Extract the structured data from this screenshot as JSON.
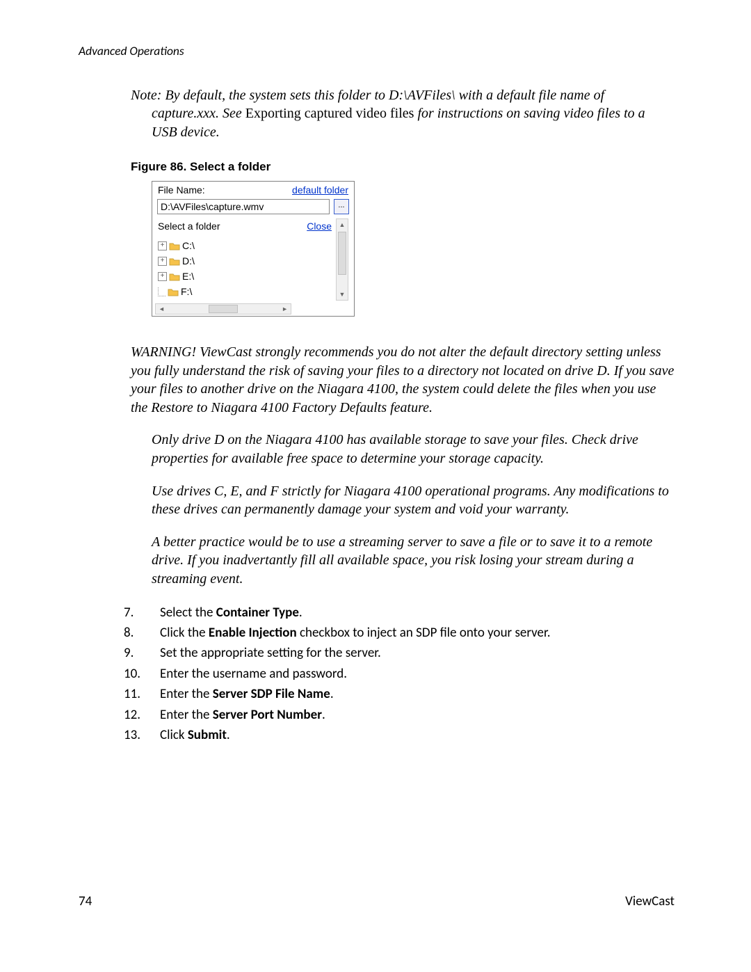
{
  "header": {
    "section_title": "Advanced Operations"
  },
  "note": {
    "prefix": "Note: ",
    "line1_a": "By default, the system sets this folder to D:\\AVFiles\\ with a default file name of ",
    "line2_a": "capture.xxx. See ",
    "line2_plain": "Exporting captured video files",
    "line2_b": " for instructions on saving video files to a ",
    "line3": "USB device."
  },
  "figure": {
    "caption": "Figure 86. Select a folder",
    "file_name_label": "File Name:",
    "default_folder_link": "default folder",
    "path_value": "D:\\AVFiles\\capture.wmv",
    "browse_label": "...",
    "select_folder_label": "Select a folder",
    "close_link": "Close",
    "drives": [
      "C:\\",
      "D:\\",
      "E:\\",
      "F:\\"
    ]
  },
  "warning": {
    "p1": "WARNING!  ViewCast strongly recommends you do not alter the default directory setting unless you fully understand the risk of saving your files to a directory not located on drive D. If you save your files to another drive on the Niagara 4100, the system could delete the files when you use the Restore to Niagara 4100 Factory Defaults feature.",
    "p2": "Only drive D on the Niagara 4100 has available storage to save your files. Check drive properties for available free space to determine your storage capacity.",
    "p3": "Use drives C, E, and F strictly for Niagara 4100 operational programs. Any modifications to these drives can permanently damage your system and void your warranty.",
    "p4": "A better practice would be to use a streaming server to save a file or to save it to a remote drive. If you inadvertantly fill all available space, you risk losing your stream during a streaming event."
  },
  "steps": [
    {
      "n": "7.",
      "pre": "Select the ",
      "bold": "Container Type",
      "post": "."
    },
    {
      "n": "8.",
      "pre": "Click the ",
      "bold": "Enable Injection",
      "post": " checkbox to inject an SDP file onto your server."
    },
    {
      "n": "9.",
      "pre": "Set the appropriate setting for the server.",
      "bold": "",
      "post": ""
    },
    {
      "n": "10.",
      "pre": "Enter the username and password.",
      "bold": "",
      "post": ""
    },
    {
      "n": "11.",
      "pre": "Enter the ",
      "bold": "Server SDP File Name",
      "post": "."
    },
    {
      "n": "12.",
      "pre": "Enter the ",
      "bold": "Server Port Number",
      "post": "."
    },
    {
      "n": "13.",
      "pre": "Click ",
      "bold": "Submit",
      "post": "."
    }
  ],
  "footer": {
    "page_number": "74",
    "brand": "ViewCast"
  }
}
